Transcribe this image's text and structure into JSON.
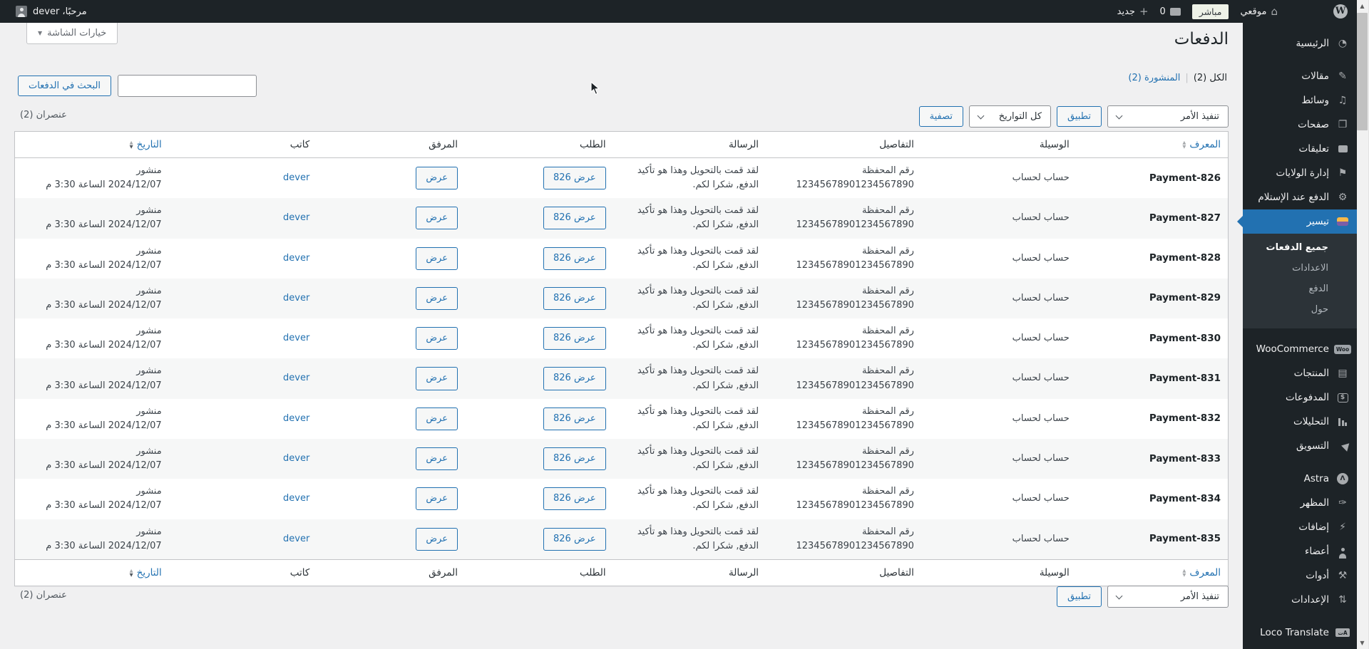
{
  "admin_bar": {
    "howdy": "مرحبًا، dever",
    "my_site": "موقعي",
    "live": "مباشر",
    "comments": "0",
    "new": "جديد"
  },
  "sidebar": {
    "items": [
      {
        "label": "الرئيسية"
      },
      {
        "label": "مقالات"
      },
      {
        "label": "وسائط"
      },
      {
        "label": "صفحات"
      },
      {
        "label": "تعليقات"
      },
      {
        "label": "إدارة الولايات"
      },
      {
        "label": "الدفع عند الإستلام"
      },
      {
        "label": "تيسير"
      },
      {
        "label": "WooCommerce"
      },
      {
        "label": "المنتجات"
      },
      {
        "label": "المدفوعات"
      },
      {
        "label": "التحليلات"
      },
      {
        "label": "التسويق"
      },
      {
        "label": "Astra"
      },
      {
        "label": "المظهر"
      },
      {
        "label": "إضافات"
      },
      {
        "label": "أعضاء"
      },
      {
        "label": "أدوات"
      },
      {
        "label": "الإعدادات"
      },
      {
        "label": "Loco Translate"
      }
    ],
    "submenu": [
      {
        "label": "جميع الدفعات"
      },
      {
        "label": "الاعدادات"
      },
      {
        "label": "الدفع"
      },
      {
        "label": "حول"
      }
    ]
  },
  "page": {
    "title": "الدفعات",
    "screen_options": "خيارات الشاشة",
    "filters": {
      "all_label": "الكل",
      "all_count": "(2)",
      "separator": "|",
      "published_label": "المنشورة",
      "published_count": "(2)"
    },
    "search_button": "البحث في الدفعات",
    "bulk_action": "تنفيذ الأمر",
    "apply": "تطبيق",
    "all_dates": "كل التواريخ",
    "filter": "تصفية",
    "items_count": "عنصران (2)"
  },
  "table": {
    "headers": [
      "المعرف",
      "الوسيلة",
      "التفاصيل",
      "الرسالة",
      "الطلب",
      "المرفق",
      "كاتب",
      "التاريخ"
    ],
    "rows": [
      {
        "id": "Payment-826",
        "method": "حساب لحساب",
        "details_line1": "رقم المحفظة",
        "details_line2": "12345678901234567890",
        "message_line1": "لقد قمت بالتحويل وهذا هو تأكيد",
        "message_line2": "الدفع, شكرا لكم.",
        "order_label": "عرض 826",
        "attachment_label": "عرض",
        "author": "dever",
        "status": "منشور",
        "date": "2024/12/07 الساعة 3:30 م"
      },
      {
        "id": "Payment-827",
        "method": "حساب لحساب",
        "details_line1": "رقم المحفظة",
        "details_line2": "12345678901234567890",
        "message_line1": "لقد قمت بالتحويل وهذا هو تأكيد",
        "message_line2": "الدفع, شكرا لكم.",
        "order_label": "عرض 826",
        "attachment_label": "عرض",
        "author": "dever",
        "status": "منشور",
        "date": "2024/12/07 الساعة 3:30 م"
      },
      {
        "id": "Payment-828",
        "method": "حساب لحساب",
        "details_line1": "رقم المحفظة",
        "details_line2": "12345678901234567890",
        "message_line1": "لقد قمت بالتحويل وهذا هو تأكيد",
        "message_line2": "الدفع, شكرا لكم.",
        "order_label": "عرض 826",
        "attachment_label": "عرض",
        "author": "dever",
        "status": "منشور",
        "date": "2024/12/07 الساعة 3:30 م"
      },
      {
        "id": "Payment-829",
        "method": "حساب لحساب",
        "details_line1": "رقم المحفظة",
        "details_line2": "12345678901234567890",
        "message_line1": "لقد قمت بالتحويل وهذا هو تأكيد",
        "message_line2": "الدفع, شكرا لكم.",
        "order_label": "عرض 826",
        "attachment_label": "عرض",
        "author": "dever",
        "status": "منشور",
        "date": "2024/12/07 الساعة 3:30 م"
      },
      {
        "id": "Payment-830",
        "method": "حساب لحساب",
        "details_line1": "رقم المحفظة",
        "details_line2": "12345678901234567890",
        "message_line1": "لقد قمت بالتحويل وهذا هو تأكيد",
        "message_line2": "الدفع, شكرا لكم.",
        "order_label": "عرض 826",
        "attachment_label": "عرض",
        "author": "dever",
        "status": "منشور",
        "date": "2024/12/07 الساعة 3:30 م"
      },
      {
        "id": "Payment-831",
        "method": "حساب لحساب",
        "details_line1": "رقم المحفظة",
        "details_line2": "12345678901234567890",
        "message_line1": "لقد قمت بالتحويل وهذا هو تأكيد",
        "message_line2": "الدفع, شكرا لكم.",
        "order_label": "عرض 826",
        "attachment_label": "عرض",
        "author": "dever",
        "status": "منشور",
        "date": "2024/12/07 الساعة 3:30 م"
      },
      {
        "id": "Payment-832",
        "method": "حساب لحساب",
        "details_line1": "رقم المحفظة",
        "details_line2": "12345678901234567890",
        "message_line1": "لقد قمت بالتحويل وهذا هو تأكيد",
        "message_line2": "الدفع, شكرا لكم.",
        "order_label": "عرض 826",
        "attachment_label": "عرض",
        "author": "dever",
        "status": "منشور",
        "date": "2024/12/07 الساعة 3:30 م"
      },
      {
        "id": "Payment-833",
        "method": "حساب لحساب",
        "details_line1": "رقم المحفظة",
        "details_line2": "12345678901234567890",
        "message_line1": "لقد قمت بالتحويل وهذا هو تأكيد",
        "message_line2": "الدفع, شكرا لكم.",
        "order_label": "عرض 826",
        "attachment_label": "عرض",
        "author": "dever",
        "status": "منشور",
        "date": "2024/12/07 الساعة 3:30 م"
      },
      {
        "id": "Payment-834",
        "method": "حساب لحساب",
        "details_line1": "رقم المحفظة",
        "details_line2": "12345678901234567890",
        "message_line1": "لقد قمت بالتحويل وهذا هو تأكيد",
        "message_line2": "الدفع, شكرا لكم.",
        "order_label": "عرض 826",
        "attachment_label": "عرض",
        "author": "dever",
        "status": "منشور",
        "date": "2024/12/07 الساعة 3:30 م"
      },
      {
        "id": "Payment-835",
        "method": "حساب لحساب",
        "details_line1": "رقم المحفظة",
        "details_line2": "12345678901234567890",
        "message_line1": "لقد قمت بالتحويل وهذا هو تأكيد",
        "message_line2": "الدفع, شكرا لكم.",
        "order_label": "عرض 826",
        "attachment_label": "عرض",
        "author": "dever",
        "status": "منشور",
        "date": "2024/12/07 الساعة 3:30 م"
      }
    ]
  },
  "icons": {
    "wordpress_logo": "W",
    "home": "⌂",
    "plus": "+",
    "caret_down": "▼",
    "sort_up": "▲",
    "sort_down": "▼",
    "dashboard": "◔",
    "posts": "✎",
    "media": "♫",
    "pages": "❐",
    "states": "⚑",
    "gear": "⚙",
    "woo": "Woo",
    "products": "▤",
    "dollar": "$",
    "astra": "Λ",
    "appearance": "✑",
    "plugins": "⚡",
    "tools": "⚒",
    "settings": "⇅",
    "loco": "Aت"
  },
  "colors": {
    "accent_blue": "#2271b1",
    "admin_bar_bg": "#1d2327",
    "submenu_bg": "#2c3338",
    "content_bg": "#f0f0f1",
    "table_border": "#c3c4c7",
    "row_stripe": "#f6f7f7"
  }
}
